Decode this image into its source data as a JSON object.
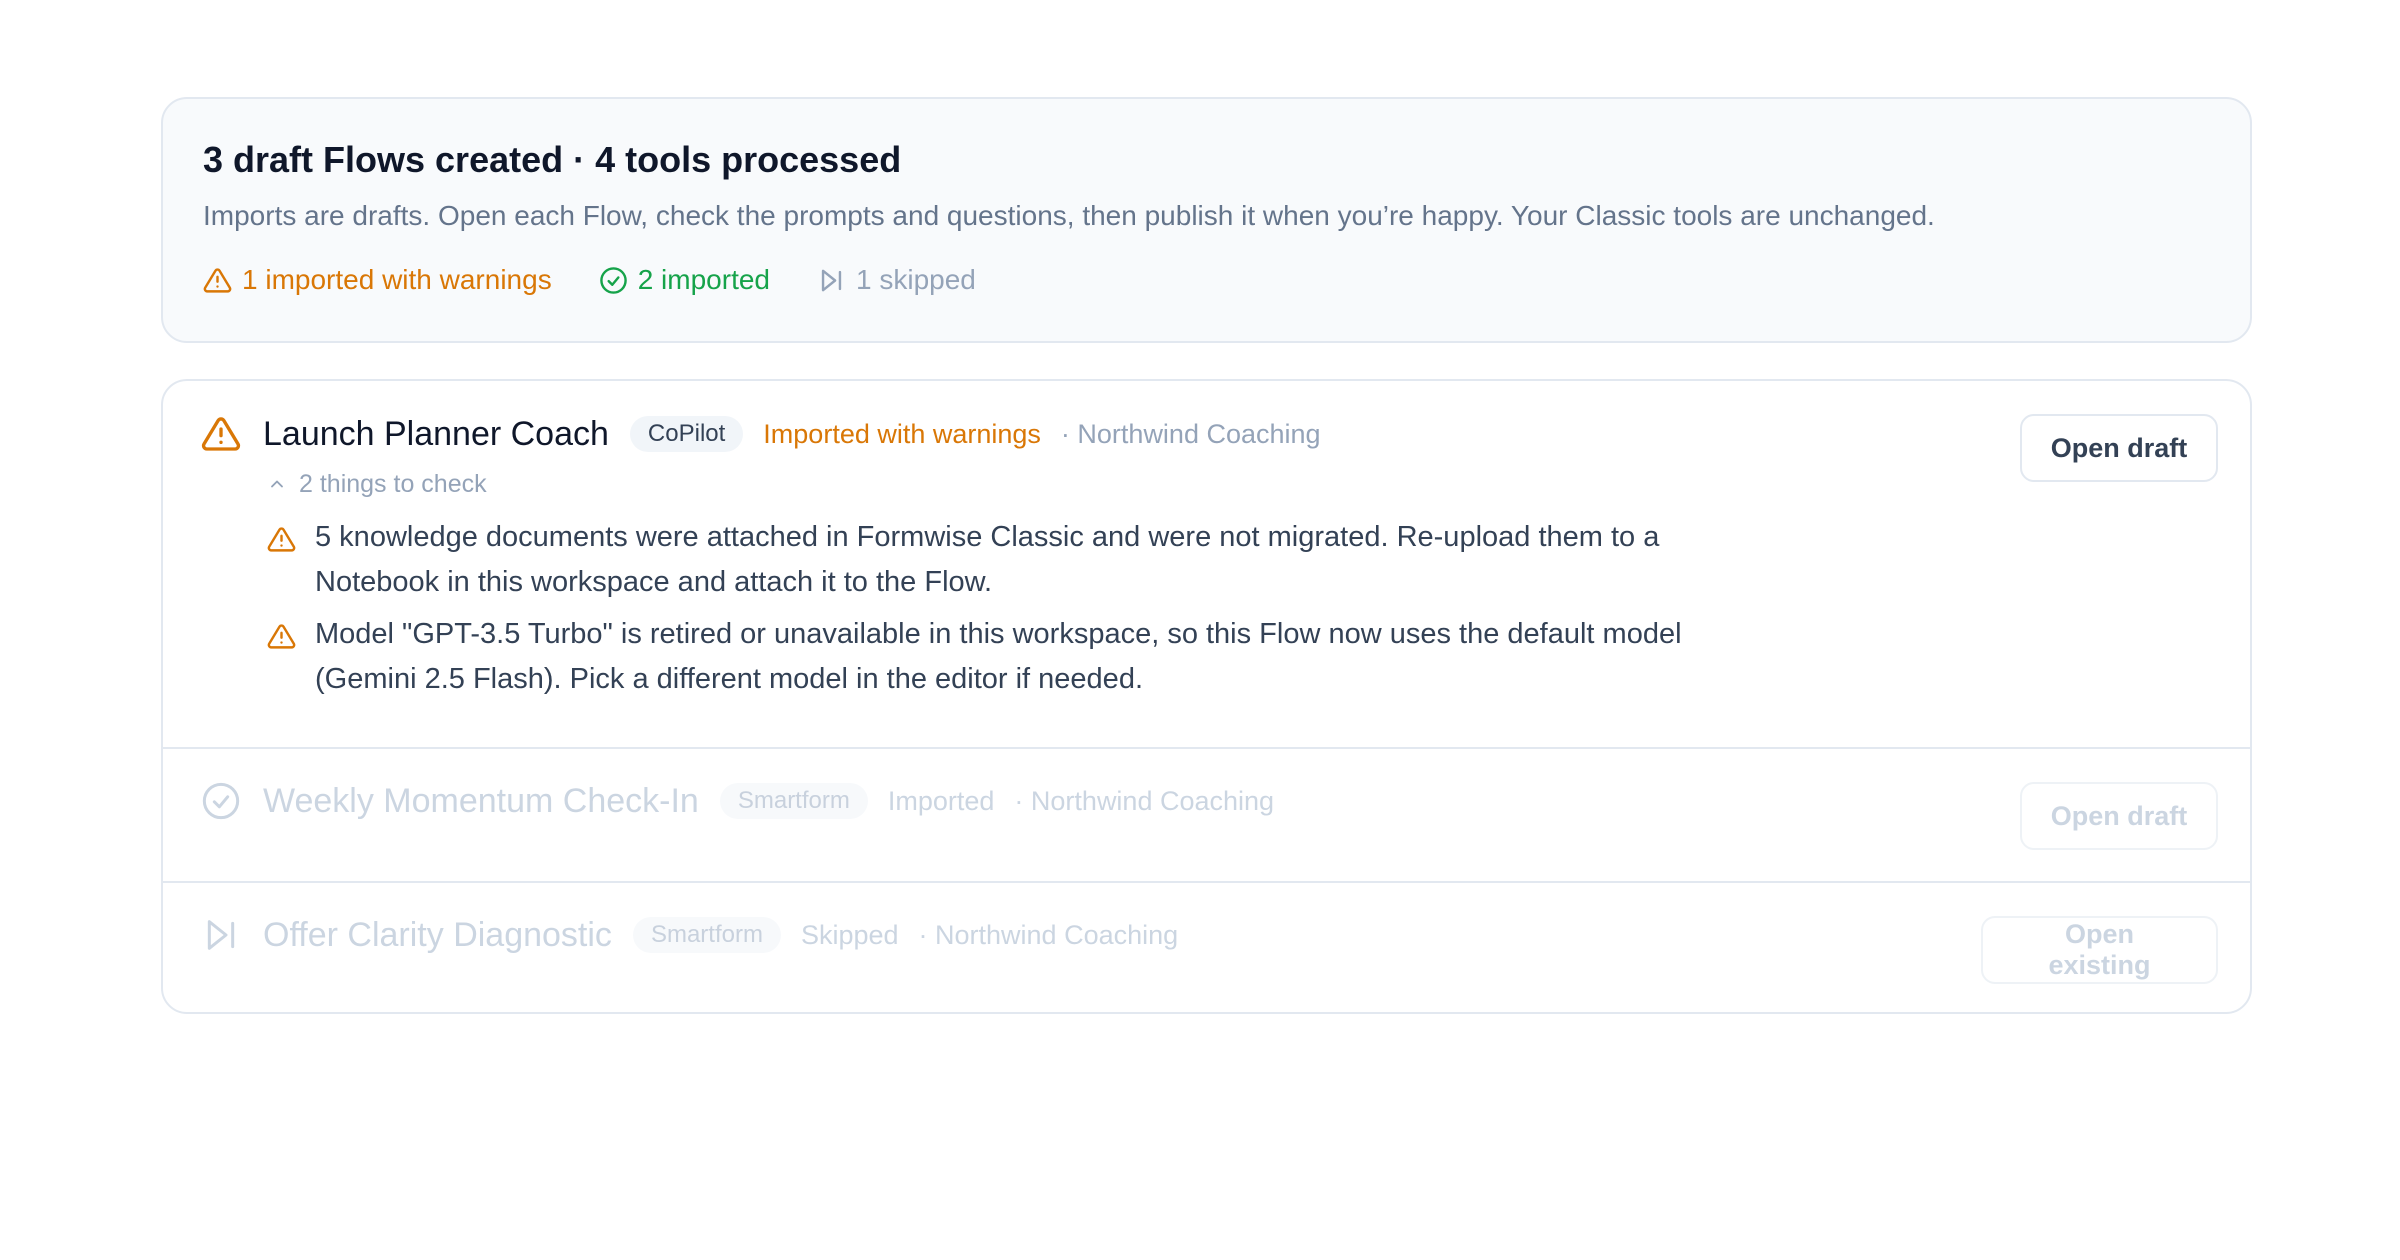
{
  "summary": {
    "title": "3 draft Flows created · 4 tools processed",
    "description": "Imports are drafts. Open each Flow, check the prompts and questions, then publish it when you’re happy. Your Classic tools are unchanged.",
    "stats": {
      "warnings": "1 imported with warnings",
      "imported": "2 imported",
      "skipped": "1 skipped"
    }
  },
  "rows": [
    {
      "name": "Launch Planner Coach",
      "badge": "CoPilot",
      "status": "Imported with warnings",
      "org": "· Northwind Coaching",
      "button": "Open draft",
      "icon": "warning-icon",
      "toggle_label": "2 things to check",
      "issues": [
        "5 knowledge documents were attached in Formwise Classic and were not migrated. Re-upload them to a Notebook in this workspace and attach it to the Flow.",
        "Model \"GPT-3.5 Turbo\" is retired or unavailable in this workspace, so this Flow now uses the default model (Gemini 2.5 Flash). Pick a different model in the editor if needed."
      ]
    },
    {
      "name": "Weekly Momentum Check-In",
      "badge": "Smartform",
      "status": "Imported",
      "org": "· Northwind Coaching",
      "button": "Open draft",
      "icon": "check-circle-icon"
    },
    {
      "name": "Offer Clarity Diagnostic",
      "badge": "Smartform",
      "status": "Skipped",
      "org": "· Northwind Coaching",
      "button": "Open existing",
      "icon": "skip-icon"
    }
  ],
  "colors": {
    "warning": "#d97706",
    "success": "#16a34a",
    "muted": "#94a3b8",
    "text": "#0f172a",
    "border": "#e2e8f0"
  }
}
